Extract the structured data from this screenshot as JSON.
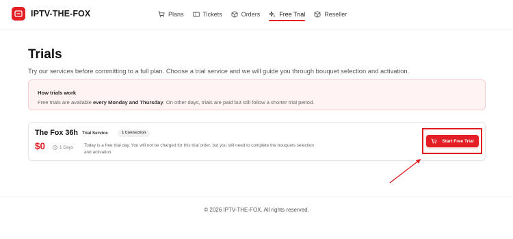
{
  "header": {
    "brand": "IPTV-THE-FOX",
    "nav": [
      {
        "label": "Plans",
        "icon": "cart-icon",
        "active": false
      },
      {
        "label": "Tickets",
        "icon": "ticket-icon",
        "active": false
      },
      {
        "label": "Orders",
        "icon": "box-icon",
        "active": false
      },
      {
        "label": "Free Trial",
        "icon": "sparkle-icon",
        "active": true
      },
      {
        "label": "Reseller",
        "icon": "box-icon",
        "active": false
      }
    ]
  },
  "page": {
    "title": "Trials",
    "subtitle": "Try our services before committing to a full plan. Choose a trial service and we will guide you through bouquet selection and activation."
  },
  "info": {
    "title": "How trials work",
    "text_before": "Free trials are available ",
    "text_bold": "every Monday and Thursday",
    "text_after": ". On other days, trials are paid but still follow a shorter trial period."
  },
  "trial_card": {
    "name": "The Fox 36h",
    "service_tag": "Trial Service",
    "connections": "1 Connection",
    "price": "$0",
    "duration": "1 Days",
    "description": "Today is a free trial day. You will not be charged for this trial order, but you still need to complete the bouquets selection and activation.",
    "button_label": "Start Free Trial"
  },
  "footer": {
    "copyright": "© 2026 IPTV-THE-FOX. All rights reserved."
  },
  "colors": {
    "accent": "#e31e24",
    "info_bg": "#fff3f3",
    "info_border": "#f6cccc"
  }
}
